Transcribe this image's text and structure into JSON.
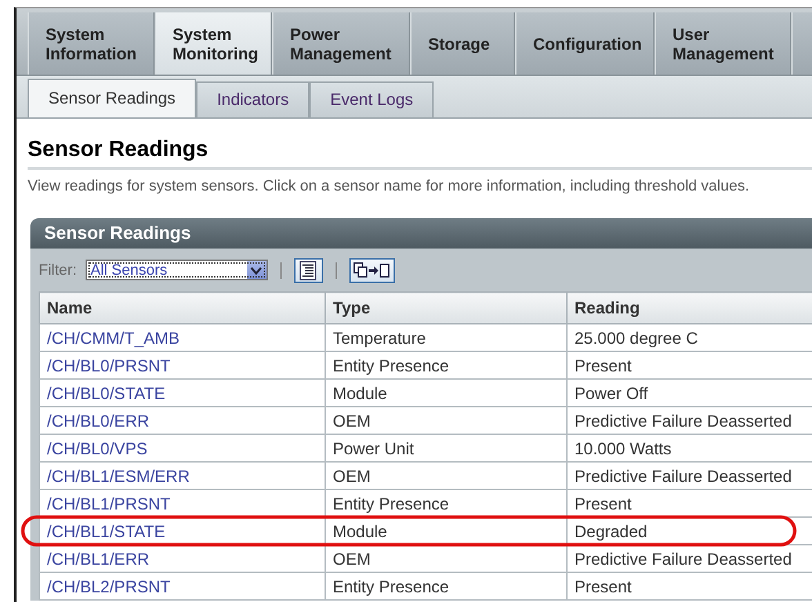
{
  "main_tabs": [
    {
      "label": "System Information",
      "selected": false
    },
    {
      "label": "System Monitoring",
      "selected": true
    },
    {
      "label": "Power Management",
      "selected": false
    },
    {
      "label": "Storage",
      "selected": false
    },
    {
      "label": "Configuration",
      "selected": false
    },
    {
      "label": "User Management",
      "selected": false
    }
  ],
  "sub_tabs": [
    {
      "label": "Sensor Readings",
      "selected": true
    },
    {
      "label": "Indicators",
      "selected": false
    },
    {
      "label": "Event Logs",
      "selected": false
    }
  ],
  "page": {
    "title": "Sensor Readings",
    "description": "View readings for system sensors. Click on a sensor name for more information, including threshold values."
  },
  "panel": {
    "title": "Sensor Readings",
    "filter_label": "Filter:",
    "filter_value": "All Sensors"
  },
  "table": {
    "columns": [
      "Name",
      "Type",
      "Reading"
    ],
    "rows": [
      {
        "name": "/CH/CMM/T_AMB",
        "type": "Temperature",
        "reading": "25.000 degree C",
        "circled": false
      },
      {
        "name": "/CH/BL0/PRSNT",
        "type": "Entity Presence",
        "reading": "Present",
        "circled": false
      },
      {
        "name": "/CH/BL0/STATE",
        "type": "Module",
        "reading": "Power Off",
        "circled": false
      },
      {
        "name": "/CH/BL0/ERR",
        "type": "OEM",
        "reading": "Predictive Failure Deasserted",
        "circled": false
      },
      {
        "name": "/CH/BL0/VPS",
        "type": "Power Unit",
        "reading": "10.000 Watts",
        "circled": false
      },
      {
        "name": "/CH/BL1/ESM/ERR",
        "type": "OEM",
        "reading": "Predictive Failure Deasserted",
        "circled": false
      },
      {
        "name": "/CH/BL1/PRSNT",
        "type": "Entity Presence",
        "reading": "Present",
        "circled": false
      },
      {
        "name": "/CH/BL1/STATE",
        "type": "Module",
        "reading": "Degraded",
        "circled": true
      },
      {
        "name": "/CH/BL1/ERR",
        "type": "OEM",
        "reading": "Predictive Failure Deasserted",
        "circled": false
      },
      {
        "name": "/CH/BL2/PRSNT",
        "type": "Entity Presence",
        "reading": "Present",
        "circled": false
      }
    ]
  }
}
